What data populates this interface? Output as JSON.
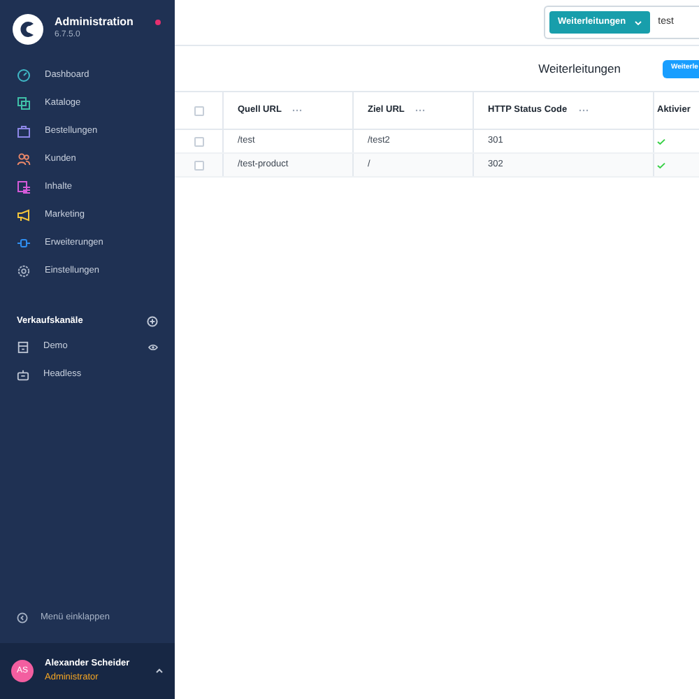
{
  "sidebar": {
    "title": "Administration",
    "version": "6.7.5.0",
    "notification": true,
    "items": [
      {
        "label": "Dashboard",
        "kind": "dashboard",
        "color": "#3fb8c6"
      },
      {
        "label": "Kataloge",
        "kind": "catalog",
        "color": "#3fbfa7"
      },
      {
        "label": "Bestellungen",
        "kind": "bag",
        "color": "#8c86e6"
      },
      {
        "label": "Kunden",
        "kind": "users",
        "color": "#f08a6a"
      },
      {
        "label": "Inhalte",
        "kind": "content",
        "color": "#d45ad8"
      },
      {
        "label": "Marketing",
        "kind": "megaphone",
        "color": "#f5c63b"
      },
      {
        "label": "Erweiterungen",
        "kind": "plug",
        "color": "#2f8ef0"
      },
      {
        "label": "Einstellungen",
        "kind": "gear",
        "color": "#a7b3c6"
      }
    ],
    "channels_heading": "Verkaufskanäle",
    "channels": [
      {
        "label": "Demo",
        "kind": "storefront",
        "visible": true
      },
      {
        "label": "Headless",
        "kind": "robot",
        "visible": false
      }
    ],
    "collapse": "Menü einklappen",
    "user": {
      "initials": "AS",
      "name": "Alexander Scheider",
      "role": "Administrator"
    }
  },
  "search": {
    "scope": "Weiterleitungen",
    "value": "test"
  },
  "header": {
    "title": "Weiterleitungen",
    "button": "Weiterle"
  },
  "table": {
    "all_selected": false,
    "columns": [
      "Quell URL",
      "Ziel URL",
      "HTTP Status Code",
      "Aktivier"
    ],
    "rows": [
      {
        "source": "/test",
        "target": "/test2",
        "code": "301",
        "active": true,
        "selected": false
      },
      {
        "source": "/test-product",
        "target": "/",
        "code": "302",
        "active": true,
        "selected": false
      }
    ]
  }
}
